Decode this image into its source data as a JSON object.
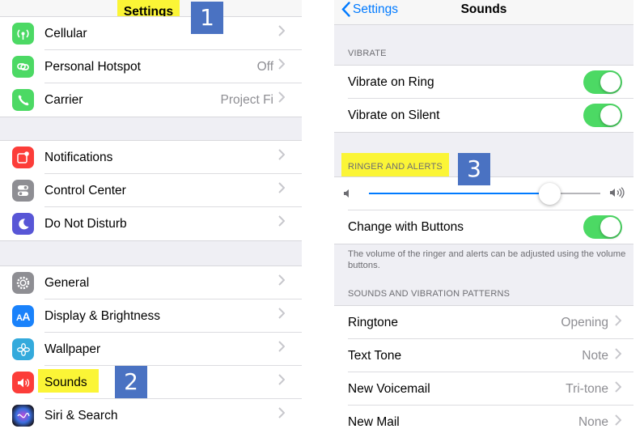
{
  "settings": {
    "title": "Settings",
    "group1": [
      {
        "label": "Cellular",
        "value": "",
        "icon": "cellular-icon",
        "color": "#4cd964"
      },
      {
        "label": "Personal Hotspot",
        "value": "Off",
        "icon": "hotspot-icon",
        "color": "#4cd964"
      },
      {
        "label": "Carrier",
        "value": "Project Fi",
        "icon": "phone-icon",
        "color": "#4cd964"
      }
    ],
    "group2": [
      {
        "label": "Notifications",
        "value": "",
        "icon": "notifications-icon",
        "color": "#fc3d39"
      },
      {
        "label": "Control Center",
        "value": "",
        "icon": "control-center-icon",
        "color": "#8e8e93"
      },
      {
        "label": "Do Not Disturb",
        "value": "",
        "icon": "moon-icon",
        "color": "#5856d6"
      }
    ],
    "group3": [
      {
        "label": "General",
        "value": "",
        "icon": "gear-icon",
        "color": "#8e8e93"
      },
      {
        "label": "Display & Brightness",
        "value": "",
        "icon": "display-icon",
        "color": "#1a82fb"
      },
      {
        "label": "Wallpaper",
        "value": "",
        "icon": "wallpaper-icon",
        "color": "#34aadc"
      },
      {
        "label": "Sounds",
        "value": "",
        "icon": "sounds-icon",
        "color": "#fc3d39"
      },
      {
        "label": "Siri & Search",
        "value": "",
        "icon": "siri-icon",
        "color": "#2d2d3a"
      }
    ]
  },
  "sounds": {
    "back_label": "Settings",
    "title": "Sounds",
    "vibrate_header": "VIBRATE",
    "vibrate_on_ring": "Vibrate on Ring",
    "vibrate_on_silent": "Vibrate on Silent",
    "ringer_header": "RINGER AND ALERTS",
    "volume_level": 0.78,
    "change_with_buttons": "Change with Buttons",
    "footnote": "The volume of the ringer and alerts can be adjusted using the volume buttons.",
    "patterns_header": "SOUNDS AND VIBRATION PATTERNS",
    "patterns": [
      {
        "label": "Ringtone",
        "value": "Opening"
      },
      {
        "label": "Text Tone",
        "value": "Note"
      },
      {
        "label": "New Voicemail",
        "value": "Tri-tone"
      },
      {
        "label": "New Mail",
        "value": "None"
      }
    ]
  },
  "annotations": {
    "step1": "1",
    "step2": "2",
    "step3": "3"
  },
  "colors": {
    "highlight": "#fbf536",
    "badge": "#4a72c2",
    "toggle_on": "#4cd964",
    "ios_blue": "#007aff"
  }
}
